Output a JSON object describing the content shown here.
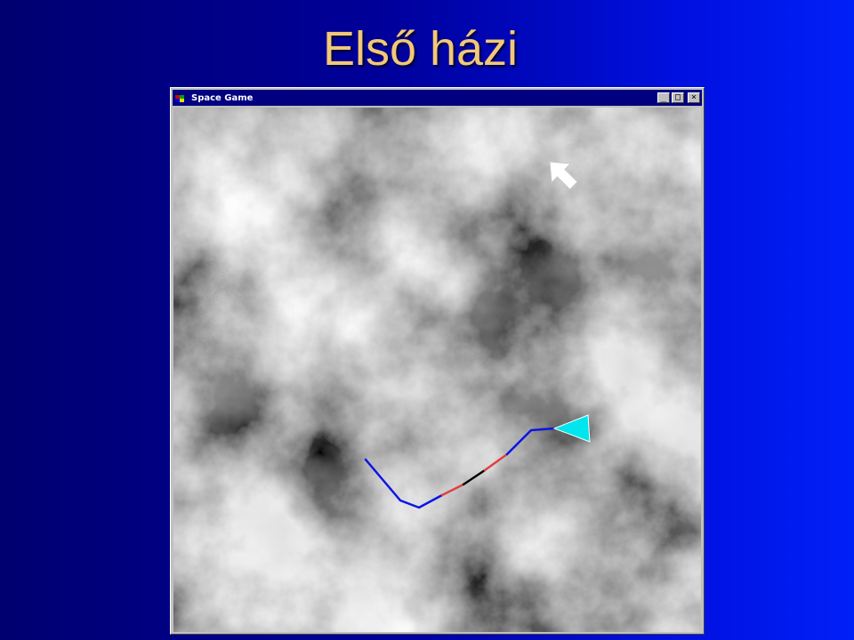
{
  "slide": {
    "title": "Első házi"
  },
  "window": {
    "title": "Space Game",
    "controls": {
      "minimize": "_",
      "maximize": "□",
      "close": "×"
    }
  },
  "game": {
    "background": "grayscale-cloud-noise",
    "ship_color": "#00e5ee",
    "path_colors": {
      "normal": "#0a14e6",
      "highlight": "#e04040",
      "alternate": "#000000"
    },
    "cursor": "white-arrow-pointer"
  }
}
